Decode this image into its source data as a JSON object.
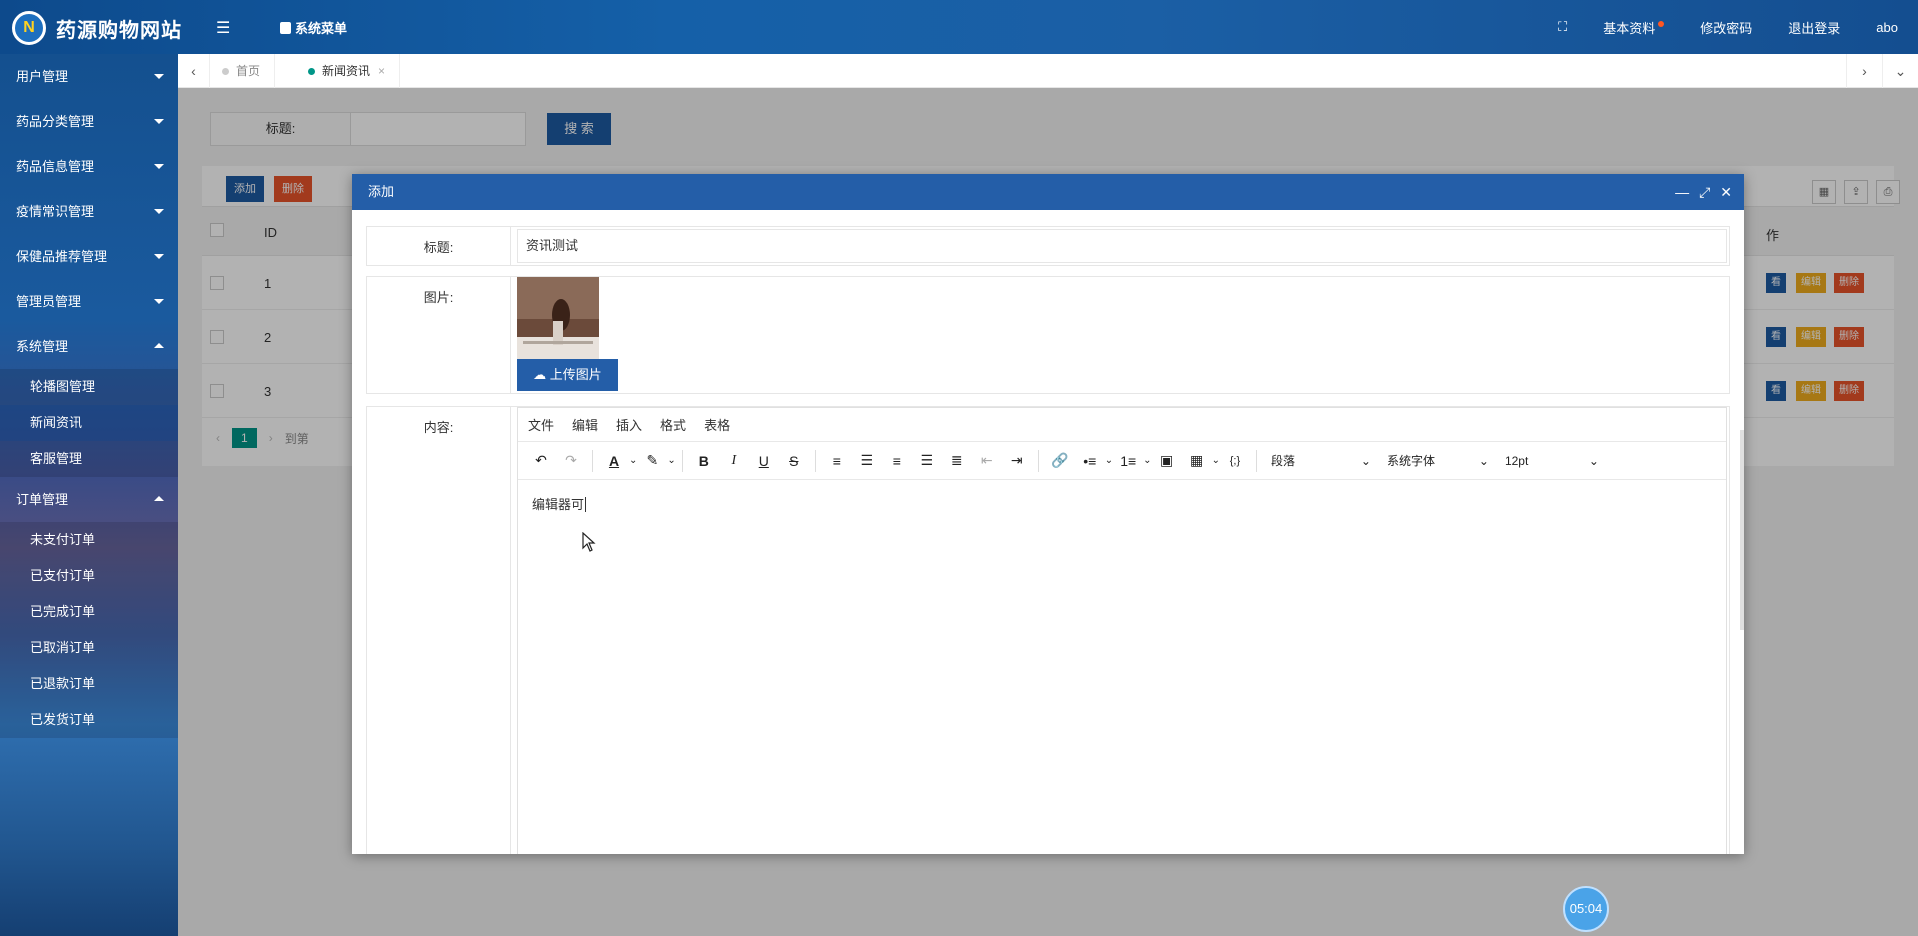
{
  "header": {
    "site_title": "药源购物网站",
    "logo_letter": "N",
    "system_menu_label": "系统菜单",
    "basic_info_label": "基本资料",
    "change_password_label": "修改密码",
    "logout_label": "退出登录",
    "username": "abo"
  },
  "sidebar": {
    "items": [
      {
        "label": "用户管理"
      },
      {
        "label": "药品分类管理"
      },
      {
        "label": "药品信息管理"
      },
      {
        "label": "疫情常识管理"
      },
      {
        "label": "保健品推荐管理"
      },
      {
        "label": "管理员管理"
      },
      {
        "label": "系统管理"
      },
      {
        "label": "订单管理"
      }
    ],
    "system_sub": [
      "轮播图管理",
      "新闻资讯",
      "客服管理"
    ],
    "order_sub": [
      "未支付订单",
      "已支付订单",
      "已完成订单",
      "已取消订单",
      "已退款订单",
      "已发货订单"
    ]
  },
  "tabs": [
    {
      "label": "首页"
    },
    {
      "label": "新闻资讯"
    }
  ],
  "content": {
    "search_label": "标题:",
    "search_button": "搜 索",
    "add_button": "添加",
    "delete_button": "删除",
    "id_header": "ID",
    "action_header": "作",
    "rows": [
      {
        "id": "1"
      },
      {
        "id": "2"
      },
      {
        "id": "3"
      }
    ],
    "row_actions": {
      "view": "看",
      "edit": "编辑",
      "delete": "删除"
    },
    "pager_page": "1",
    "pager_goto": "到第"
  },
  "modal": {
    "title": "添加",
    "title_label": "标题:",
    "title_value": "资讯测试",
    "image_label": "图片:",
    "upload_label": "上传图片",
    "content_label": "内容:",
    "editor_menu": [
      "文件",
      "编辑",
      "插入",
      "格式",
      "表格"
    ],
    "block_format": "段落",
    "font_family": "系统字体",
    "font_size": "12pt",
    "editor_text": "编辑器可"
  },
  "timer": "05:04",
  "colors": {
    "primary": "#245ea8",
    "danger": "#e8542a",
    "warning": "#f0ad1e",
    "teal": "#009688"
  }
}
